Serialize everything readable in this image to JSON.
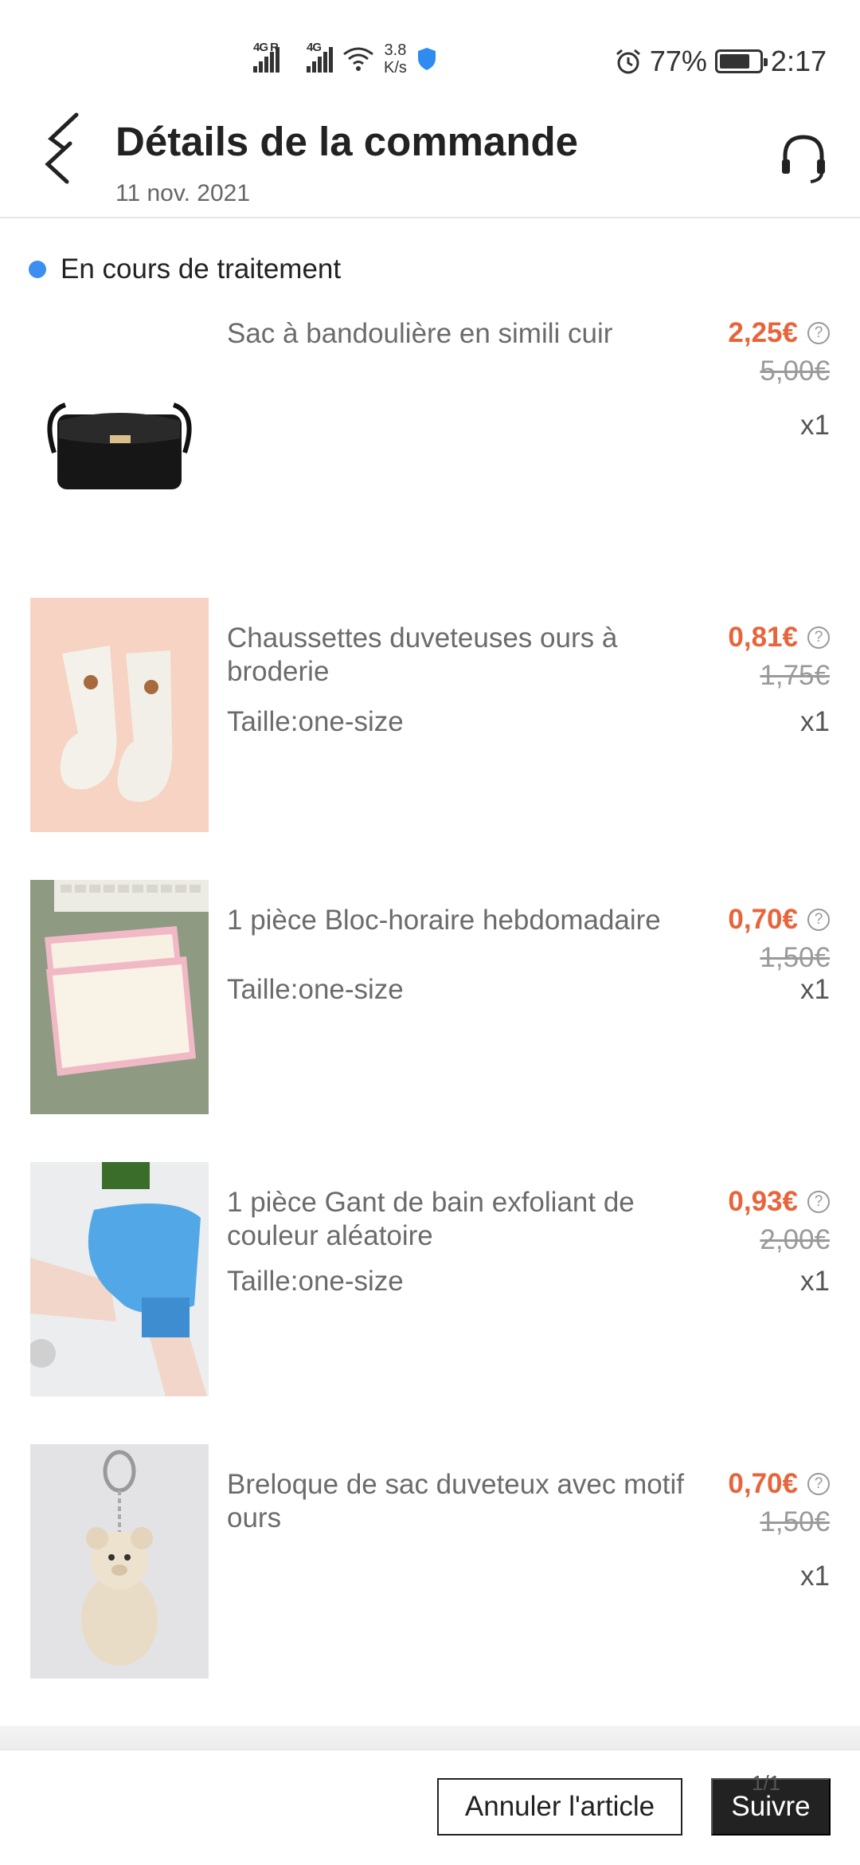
{
  "status_bar": {
    "network1": "4G R",
    "network2": "4G",
    "speed_value": "3.8",
    "speed_unit": "K/s",
    "battery": "77%",
    "battery_level": 0.77,
    "time": "2:17"
  },
  "header": {
    "title": "Détails de la commande",
    "date": "11 nov. 2021",
    "back_icon": "chevron-back-icon",
    "support_icon": "headset-icon"
  },
  "order_status": {
    "label": "En cours de traitement",
    "dot_color": "#3d8ef0"
  },
  "items": [
    {
      "name": "Sac à bandoulière en simili cuir",
      "size": "",
      "price": "2,25€",
      "old_price": "5,00€",
      "qty": "x1",
      "image": "black-shoulder-bag"
    },
    {
      "name": "Chaussettes duveteuses ours à broderie",
      "size": "Taille:one-size",
      "price": "0,81€",
      "old_price": "1,75€",
      "qty": "x1",
      "image": "fluffy-bear-socks"
    },
    {
      "name": "1 pièce Bloc-horaire hebdomadaire",
      "size": "Taille:one-size",
      "price": "0,70€",
      "old_price": "1,50€",
      "qty": "x1",
      "image": "weekly-schedule-pad"
    },
    {
      "name": "1 pièce Gant de bain exfoliant de couleur aléatoire",
      "size": "Taille:one-size",
      "price": "0,93€",
      "old_price": "2,00€",
      "qty": "x1",
      "image": "blue-exfoliating-glove"
    },
    {
      "name": "Breloque de sac duveteux avec motif ours",
      "size": "",
      "price": "0,70€",
      "old_price": "1,50€",
      "qty": "x1",
      "image": "teddy-bear-keychain"
    }
  ],
  "price_help_symbol": "?",
  "footer": {
    "cancel_label": "Annuler l'article",
    "track_label": "Suivre",
    "pager": "1/1"
  },
  "colors": {
    "price": "#e8643a",
    "accent_dot": "#3d8ef0",
    "primary_button": "#222222"
  }
}
